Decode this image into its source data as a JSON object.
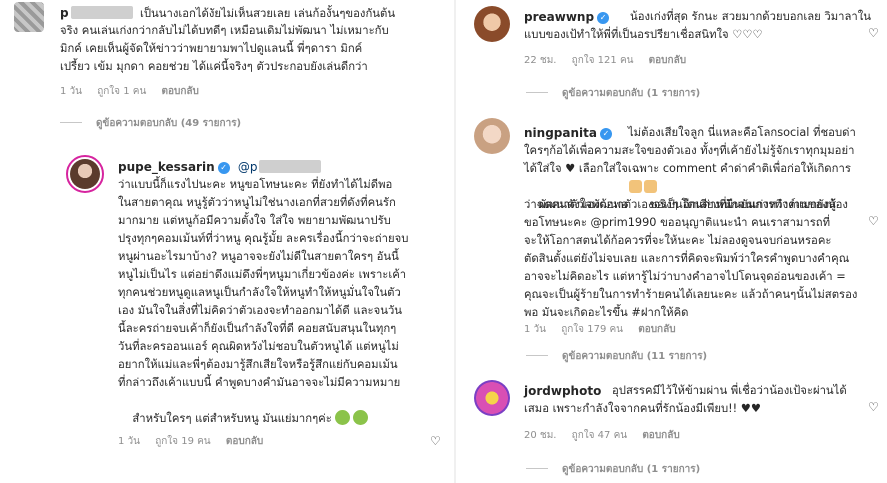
{
  "left": {
    "top_comment": {
      "username_visible": "p",
      "lines": [
        "เป็นนางเอกได้งัยไม่เห็นสวยเลย เล่นก้องั้นๆของกันต้น",
        "จริง คนเล่นเก่งกว่ากลับไม่ได้บทดีๆ เหมือนเดิมไม่พัฒนา ไม่เหมาะกับ",
        "มิกค์ เคยเห็นผู้จัดให้ข่าวว่าพยายามพาไปดูแลนนี้ พี่ๆดารา มิกค์",
        "เปรี้ยว เข้ม มุกดา คอยช่วย ได้แค่นี้จริงๆ ตัวประกอบยังเล่นดีกว่า"
      ],
      "time": "1 วัน",
      "likes": "ถูกใจ 1 คน",
      "reply": "ตอบกลับ"
    },
    "view_replies": "ดูข้อความตอบกลับ (49 รายการ)",
    "reply_comment": {
      "username": "pupe_kessarin",
      "mention": "@p",
      "lines": [
        "ว่าแบบนี้ก็แรงไปนะคะ หนูขอโทษนะคะ ที่ยังทำได้ไม่ดีพอ",
        "ในสายตาคุณ หนูรู้ตัวว่าหนูไม่ใช่นางเอกที่สวยที่ดังที่คนรัก",
        "มากมาย แต่หนูก้อมีความตั้งใจ ใส่ใจ พยายามพัฒนาปรับ",
        "ปรุงทุกๆคอมเม้นท์ที่ว่าหนู คุณรู้มั้ย ละครเรื่องนี้กว่าจะถ่ายจบ",
        "หนูผ่านอะไรมาบ้าง? หนูอาจจะยังไม่ดีในสายตาใครๆ อันนี้",
        "หนูไม่เป็นไร แต่อย่าดึงแม่ดึงพี่ๆหนูมาเกี่ยวข้องค่ะ เพราะเค้า",
        "ทุกคนช่วยหนูดูแลหนูเป็นกำลังใจให้หนูทำให้หนูมั่นใจในตัว",
        "เอง มันใจในสิ่งที่ไม่คิดว่าตัวเองจะทำออกมาได้ดี และจนวัน",
        "นี้ละครถ่ายจบเค้าก็ยังเป็นกำลังใจที่ดี คอยสนับสนุนในทุกๆ",
        "วันที่ละครออนแอร์ คุณผิดหวังไม่ชอบในตัวหนูได้ แต่หนูไม่",
        "อยากให้แม่และพี่ๆต้องมารู้สึกเสียใจหรือรู้สึกแย่กับคอมเม้น",
        "ที่กล่าวถึงเค้าแบบนี้ คำพูดบางคำมันอาจจะไม่มีความหมาย",
        "สำหรับใครๆ แต่สำหรับหนู มันแย่มากๆค่ะ"
      ],
      "time": "1 วัน",
      "likes": "ถูกใจ 19 คน",
      "reply": "ตอบกลับ"
    }
  },
  "right": {
    "comments": [
      {
        "username": "preawwnp",
        "lines": [
          "น้องเก่งที่สุด รักนะ สวยมากด้วยบอกเลย วิมาลาใน",
          "แบบของเป้ทำให้พี่ที่เป็นอรปรียาเชื่อสนิทใจ ♡♡♡"
        ],
        "time": "22 ชม.",
        "likes": "ถูกใจ 121 คน",
        "reply": "ตอบกลับ",
        "view_replies": "ดูข้อความตอบกลับ (1 รายการ)"
      },
      {
        "username": "ningpanita",
        "lines": [
          "ไม่ต้องเสียใจลูก นี่แหละคือโลกsocial ที่ชอบด่า",
          "ใครๆก้อได้เพื่อความสะใจของตัวเอง ทั้งๆที่เค้ายังไม่รู้จักเราทุกมุมอย่า",
          "ได้ใส่ใจ ♥ เลือกใส่ใจเฉพาะ comment คำด่าคำติเพื่อก่อให้เกิดการ",
          "พัฒนาตัวเองก้อพอ      ขอเป็นอีกเสียงที่ยืนยันการทำงานของน้อง",
          "ว่าฉดคนดังใจพัฒนาตัวเองจริงๆ โดนด่าหนักจนเก่งหวิงค์แบกยังสู้",
          "ขอโทษนะคะ @prim1990 ขออนุญาติแนะนำ คนเราสามารถที่",
          "จะให้โอกาสตนได้ก้อควรที่จะให้นะคะ ไม่ลองดูจนจบก่อนหรอคะ",
          "ตัดสินตั้งแต่ยังไม่จบเลย และการที่คิดจะพิมพ์ว่าใครคำพูดบางคำคุณ",
          "อาจจะไม่คิดอะไร แต่หารู้ไม่ว่าบางคำอาจไปโดนจุดอ่อนของเค้า =",
          "คุณจะเป็นผู้ร้ายในการทำร้ายคนได้เลยนะคะ แล้วถ้าคนๆนั้นไม่สตรอง",
          "พอ มันจะเกิดอะไรขึ้น #ฝากให้คิด"
        ],
        "time": "1 วัน",
        "likes": "ถูกใจ 179 คน",
        "reply": "ตอบกลับ",
        "view_replies": "ดูข้อความตอบกลับ (11 รายการ)"
      },
      {
        "username": "jordwphoto",
        "lines": [
          "อุปสรรคมีไว้ให้ข้ามผ่าน พี่เชื่อว่าน้องเป้จะผ่านได้",
          "เสมอ เพราะกำลังใจจากคนที่รักน้องมีเพียบ!! ♥♥"
        ],
        "time": "20 ชม.",
        "likes": "ถูกใจ 47 คน",
        "reply": "ตอบกลับ",
        "view_replies": "ดูข้อความตอบกลับ (1 รายการ)"
      }
    ]
  }
}
